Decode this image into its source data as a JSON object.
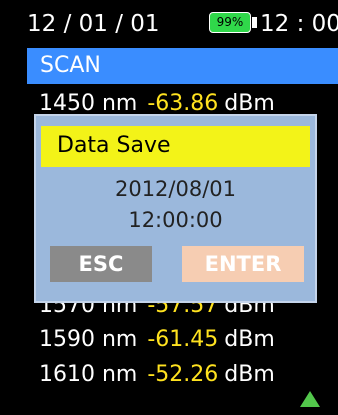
{
  "status": {
    "date": "12 / 01 / 01",
    "battery": "99%",
    "battery_color": "#30d84a",
    "time": "12 : 00"
  },
  "mode": {
    "label": "SCAN",
    "color": "#3a8dff"
  },
  "readings": [
    {
      "wavelength": "1450 nm",
      "power": "-63.86",
      "unit": "dBm"
    },
    {
      "wavelength": "1570 nm",
      "power": "-57.57",
      "unit": "dBm"
    },
    {
      "wavelength": "1590 nm",
      "power": "-61.45",
      "unit": "dBm"
    },
    {
      "wavelength": "1610 nm",
      "power": "-52.26",
      "unit": "dBm"
    }
  ],
  "scroll_indicator": "triangle-up-icon",
  "dialog": {
    "title": "Data Save",
    "date": "2012/08/01",
    "time": "12:00:00",
    "esc_label": "ESC",
    "enter_label": "ENTER"
  },
  "colors": {
    "value_yellow": "#ffe21f",
    "dialog_bg": "#9bb8dc",
    "title_bg": "#f3f318",
    "esc_bg": "#8a8a8a",
    "enter_bg": "#f6cdb2",
    "arrow": "#53c84c"
  }
}
